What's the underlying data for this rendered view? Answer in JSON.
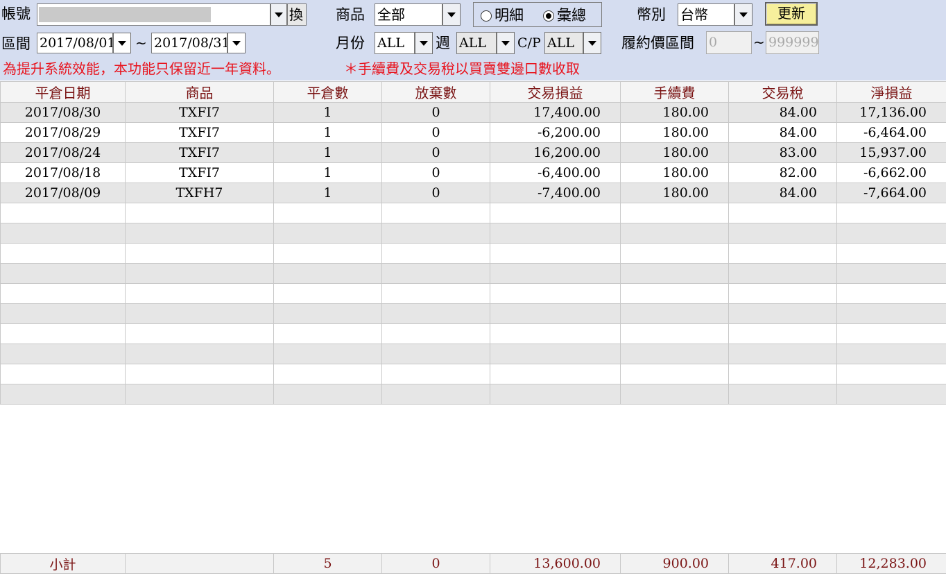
{
  "filters": {
    "account_label": "帳號",
    "account_swap_label": "換",
    "product_label": "商品",
    "product_value": "全部",
    "detail_label": "明細",
    "summary_label": "彙總",
    "currency_label": "幣別",
    "currency_value": "台幣",
    "update_label": "更新",
    "period_label": "區間",
    "date_from": "2017/08/01",
    "date_sep": "~",
    "date_to": "2017/08/31",
    "month_label": "月份",
    "month_value": "ALL",
    "week_label": "週",
    "week_value": "ALL",
    "cp_label": "C/P",
    "cp_value": "ALL",
    "strike_label": "履約價區間",
    "strike_from": "0",
    "strike_sep": "~",
    "strike_to": "999999"
  },
  "notices": {
    "retention": "為提升系統效能，本功能只保留近一年資料。",
    "fee_note": "＊手續費及交易稅以買賣雙邊口數收取"
  },
  "table": {
    "headers": [
      "平倉日期",
      "商品",
      "平倉數",
      "放棄數",
      "交易損益",
      "手續費",
      "交易稅",
      "淨損益"
    ],
    "rows": [
      [
        "2017/08/30",
        "TXFI7",
        "1",
        "0",
        "17,400.00",
        "180.00",
        "84.00",
        "17,136.00"
      ],
      [
        "2017/08/29",
        "TXFI7",
        "1",
        "0",
        "-6,200.00",
        "180.00",
        "84.00",
        "-6,464.00"
      ],
      [
        "2017/08/24",
        "TXFI7",
        "1",
        "0",
        "16,200.00",
        "180.00",
        "83.00",
        "15,937.00"
      ],
      [
        "2017/08/18",
        "TXFI7",
        "1",
        "0",
        "-6,400.00",
        "180.00",
        "82.00",
        "-6,662.00"
      ],
      [
        "2017/08/09",
        "TXFH7",
        "1",
        "0",
        "-7,400.00",
        "180.00",
        "84.00",
        "-7,664.00"
      ]
    ],
    "subtotal": [
      "小計",
      "",
      "5",
      "0",
      "13,600.00",
      "900.00",
      "417.00",
      "12,283.00"
    ]
  }
}
